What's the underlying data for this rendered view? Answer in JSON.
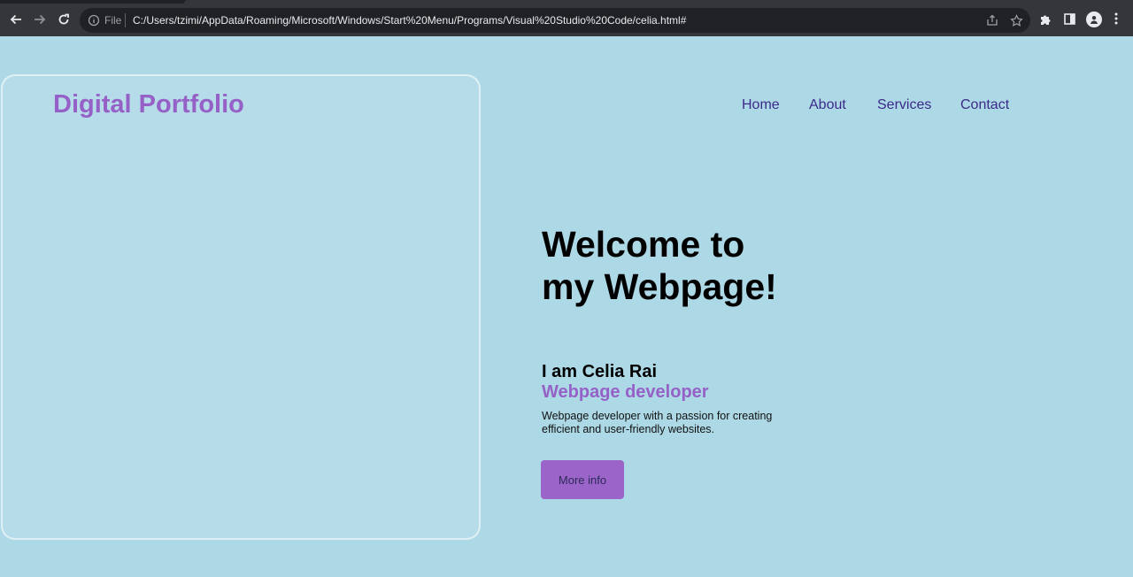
{
  "browser": {
    "scheme_label": "File",
    "url": "C:/Users/tzimi/AppData/Roaming/Microsoft/Windows/Start%20Menu/Programs/Visual%20Studio%20Code/celia.html#"
  },
  "site": {
    "logo": "Digital Portfolio",
    "nav": [
      "Home",
      "About",
      "Services",
      "Contact"
    ]
  },
  "hero": {
    "title": "Welcome to my Webpage!",
    "name": "I am Celia Rai",
    "role": "Webpage developer",
    "description": "Webpage developer with a passion for creating efficient and user-friendly websites.",
    "button": "More info"
  },
  "colors": {
    "background": "#add8e6",
    "accent": "#9661c6",
    "nav_text": "#3b2a8a",
    "button_bg": "#9b64c8"
  }
}
